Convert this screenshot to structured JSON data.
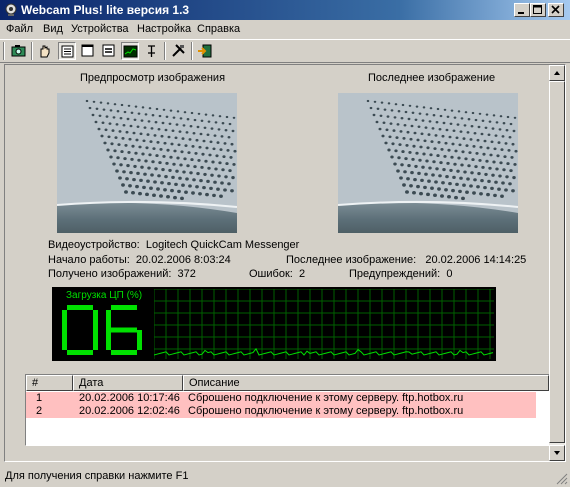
{
  "window": {
    "title": "Webcam Plus! lite версия 1.3"
  },
  "menu": {
    "items": [
      {
        "label": "Файл",
        "key": "Ф"
      },
      {
        "label": "Вид",
        "key": "В"
      },
      {
        "label": "Устройства",
        "key": "У"
      },
      {
        "label": "Настройка",
        "key": "Н"
      },
      {
        "label": "Справка",
        "key": "С"
      }
    ]
  },
  "toolbar": {
    "buttons": [
      "camera-icon",
      "hand-icon",
      "layout-a-icon",
      "layout-b-icon",
      "layout-c-icon",
      "graph-icon",
      "pin-icon",
      "tools-icon",
      "exit-icon"
    ]
  },
  "preview": {
    "caption": "Предпросмотр изображения"
  },
  "last_image": {
    "caption": "Последнее изображение"
  },
  "info": {
    "device_label": "Видеоустройство:",
    "device_value": "Logitech QuickCam Messenger",
    "start_label": "Начало работы:",
    "start_value": "20.02.2006 8:03:24",
    "last_label": "Последнее изображение:",
    "last_value": "20.02.2006 14:14:25",
    "received_label": "Получено изображений:",
    "received_value": "372",
    "errors_label": "Ошибок:",
    "errors_value": "2",
    "warnings_label": "Предупреждений:",
    "warnings_value": "0"
  },
  "cpu": {
    "label": "Загрузка ЦП (%)",
    "value": "06",
    "accent": "#00e000"
  },
  "log": {
    "columns": [
      "#",
      "Дата",
      "Описание"
    ],
    "rows": [
      {
        "num": "1",
        "date": "20.02.2006 10:17:46",
        "desc": "Сброшено подключение к этому серверу. ftp.hotbox.ru"
      },
      {
        "num": "2",
        "date": "20.02.2006 12:02:46",
        "desc": "Сброшено подключение к этому серверу. ftp.hotbox.ru"
      }
    ],
    "row_color": "#ffc0c0"
  },
  "status": {
    "text": "Для получения справки нажмите F1"
  }
}
